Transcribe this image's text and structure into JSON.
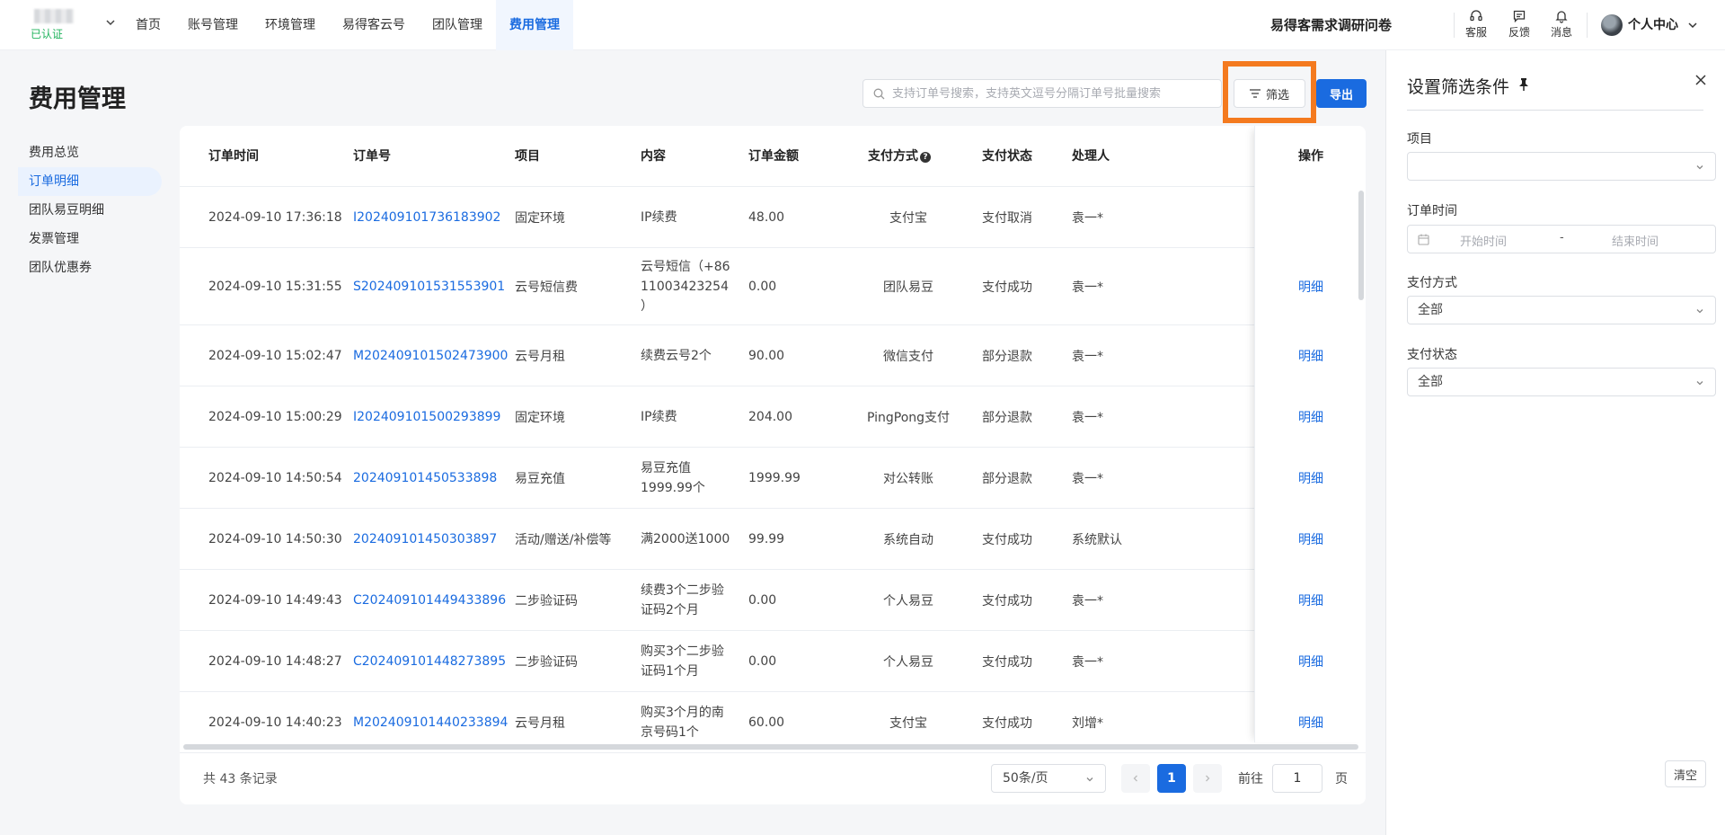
{
  "header": {
    "verified_label": "已认证",
    "nav": [
      {
        "label": "首页"
      },
      {
        "label": "账号管理"
      },
      {
        "label": "环境管理"
      },
      {
        "label": "易得客云号"
      },
      {
        "label": "团队管理"
      },
      {
        "label": "费用管理",
        "active": true
      }
    ],
    "survey": "易得客需求调研问卷",
    "tools": {
      "service": "客服",
      "feedback": "反馈",
      "message": "消息"
    },
    "user": "个人中心"
  },
  "page": {
    "title": "费用管理",
    "side_menu": [
      {
        "label": "费用总览"
      },
      {
        "label": "订单明细",
        "active": true
      },
      {
        "label": "团队易豆明细"
      },
      {
        "label": "发票管理"
      },
      {
        "label": "团队优惠券"
      }
    ]
  },
  "toolbar": {
    "search_placeholder": "支持订单号搜索，支持英文逗号分隔订单号批量搜索",
    "filter_label": "筛选",
    "export_label": "导出"
  },
  "table": {
    "columns": {
      "time": "订单时间",
      "order_no": "订单号",
      "item": "项目",
      "content": "内容",
      "amount": "订单金额",
      "pay_method": "支付方式",
      "pay_status": "支付状态",
      "handler": "处理人",
      "action": "操作"
    },
    "help_glyph": "?",
    "rows": [
      {
        "time": "2024-09-10 17:36:18",
        "order_no": "I202409101736183902",
        "item": "固定环境",
        "content": "IP续费",
        "amount": "48.00",
        "pay_method": "支付宝",
        "pay_status": "支付取消",
        "handler": "袁一*",
        "action": ""
      },
      {
        "time": "2024-09-10 15:31:55",
        "order_no": "S202409101531553901",
        "item": "云号短信费",
        "content": "云号短信（+86 11003423254 ）",
        "amount": "0.00",
        "pay_method": "团队易豆",
        "pay_status": "支付成功",
        "handler": "袁一*",
        "action": "明细"
      },
      {
        "time": "2024-09-10 15:02:47",
        "order_no": "M202409101502473900",
        "item": "云号月租",
        "content": "续费云号2个",
        "amount": "90.00",
        "pay_method": "微信支付",
        "pay_status": "部分退款",
        "handler": "袁一*",
        "action": "明细"
      },
      {
        "time": "2024-09-10 15:00:29",
        "order_no": "I202409101500293899",
        "item": "固定环境",
        "content": "IP续费",
        "amount": "204.00",
        "pay_method": "PingPong支付",
        "pay_status": "部分退款",
        "handler": "袁一*",
        "action": "明细"
      },
      {
        "time": "2024-09-10 14:50:54",
        "order_no": "202409101450533898",
        "item": "易豆充值",
        "content": "易豆充值 1999.99个",
        "amount": "1999.99",
        "pay_method": "对公转账",
        "pay_status": "部分退款",
        "handler": "袁一*",
        "action": "明细"
      },
      {
        "time": "2024-09-10 14:50:30",
        "order_no": "202409101450303897",
        "item": "活动/赠送/补偿等",
        "content": "满2000送1000",
        "amount": "99.99",
        "pay_method": "系统自动",
        "pay_status": "支付成功",
        "handler": "系统默认",
        "action": "明细"
      },
      {
        "time": "2024-09-10 14:49:43",
        "order_no": "C202409101449433896",
        "item": "二步验证码",
        "content": "续费3个二步验证码2个月",
        "amount": "0.00",
        "pay_method": "个人易豆",
        "pay_status": "支付成功",
        "handler": "袁一*",
        "action": "明细"
      },
      {
        "time": "2024-09-10 14:48:27",
        "order_no": "C202409101448273895",
        "item": "二步验证码",
        "content": "购买3个二步验证码1个月",
        "amount": "0.00",
        "pay_method": "个人易豆",
        "pay_status": "支付成功",
        "handler": "袁一*",
        "action": "明细"
      },
      {
        "time": "2024-09-10 14:40:23",
        "order_no": "M202409101440233894",
        "item": "云号月租",
        "content": "购买3个月的南京号码1个",
        "amount": "60.00",
        "pay_method": "支付宝",
        "pay_status": "支付成功",
        "handler": "刘增*",
        "action": "明细"
      }
    ]
  },
  "pagination": {
    "total_text": "共 43 条记录",
    "page_size": "50条/页",
    "current_page": "1",
    "goto_prefix": "前往",
    "goto_value": "1",
    "goto_suffix": "页"
  },
  "filter_panel": {
    "title": "设置筛选条件",
    "project_label": "项目",
    "project_value": "",
    "time_label": "订单时间",
    "start_placeholder": "开始时间",
    "range_separator": "-",
    "end_placeholder": "结束时间",
    "pay_method_label": "支付方式",
    "pay_method_value": "全部",
    "pay_status_label": "支付状态",
    "pay_status_value": "全部",
    "clear_label": "清空"
  },
  "colors": {
    "accent": "#1a6be0",
    "highlight": "#f47a1f",
    "verified": "#22b35e"
  }
}
